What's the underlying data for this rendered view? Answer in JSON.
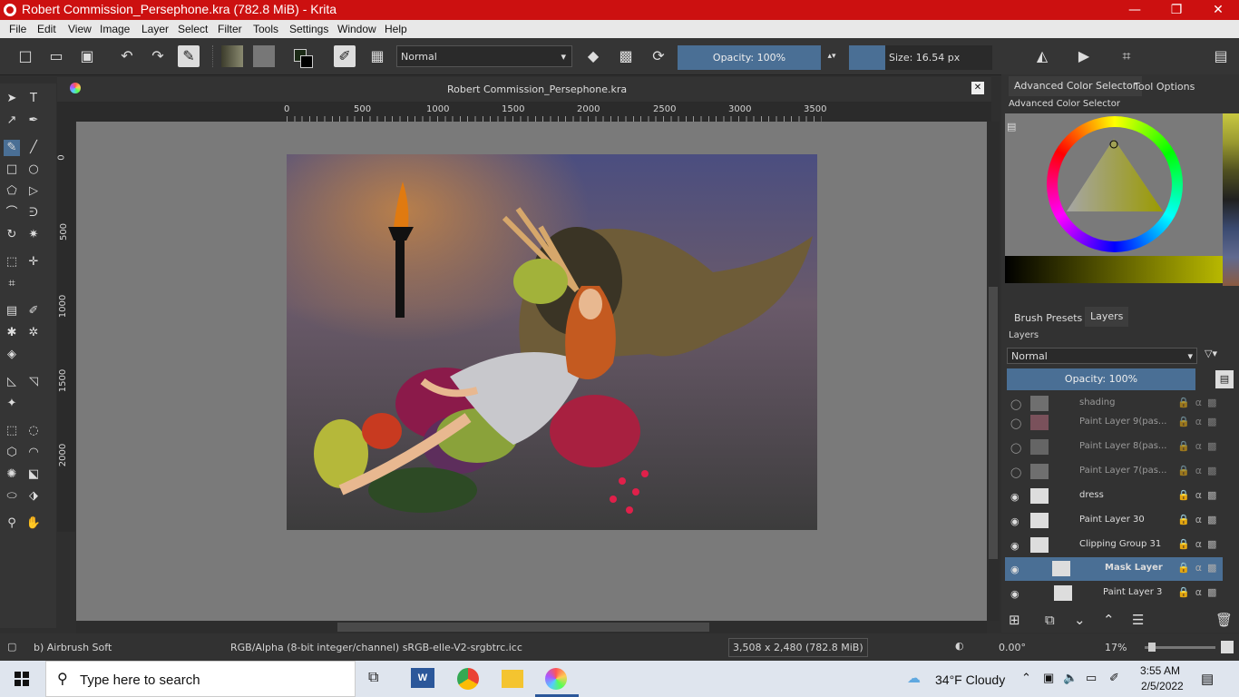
{
  "window": {
    "title": "Robert Commission_Persephone.kra (782.8 MiB)  - Krita",
    "minimize": "—",
    "maximize": "❐",
    "close": "✕"
  },
  "menu": [
    "File",
    "Edit",
    "View",
    "Image",
    "Layer",
    "Select",
    "Filter",
    "Tools",
    "Settings",
    "Window",
    "Help"
  ],
  "toolbar": {
    "blend_mode": "Normal",
    "opacity": "Opacity: 100%",
    "size": "Size: 16.54 px"
  },
  "document": {
    "tab_title": "Robert Commission_Persephone.kra"
  },
  "ruler": {
    "h_ticks": [
      "0",
      "500",
      "1000",
      "1500",
      "2000",
      "2500",
      "3000",
      "3500"
    ],
    "v_ticks": [
      "0",
      "500",
      "1000",
      "1500",
      "2000"
    ]
  },
  "right_panel": {
    "tabs": [
      "Advanced Color Selector",
      "Tool Options"
    ],
    "color_selector_title": "Advanced Color Selector",
    "lower_tabs": [
      "Brush Presets",
      "Layers"
    ],
    "layers_title": "Layers",
    "layer_blend": "Normal",
    "layer_opacity": "Opacity:  100%",
    "layers": [
      {
        "name": "shading",
        "visible": false,
        "selected": false
      },
      {
        "name": "Paint Layer 9(pas...",
        "visible": false,
        "selected": false
      },
      {
        "name": "Paint Layer 8(pas...",
        "visible": false,
        "selected": false
      },
      {
        "name": "Paint Layer 7(pas...",
        "visible": false,
        "selected": false
      },
      {
        "name": "dress",
        "visible": true,
        "selected": false
      },
      {
        "name": "Paint Layer 30",
        "visible": true,
        "selected": false
      },
      {
        "name": "Clipping Group 31",
        "visible": true,
        "selected": false
      },
      {
        "name": "Mask Layer",
        "visible": true,
        "selected": true
      },
      {
        "name": "Paint Layer 3",
        "visible": true,
        "selected": false
      }
    ]
  },
  "status": {
    "brush": "b) Airbrush Soft",
    "color_space": "RGB/Alpha (8-bit integer/channel)  sRGB-elle-V2-srgbtrc.icc",
    "dimensions": "3,508 x 2,480 (782.8 MiB)",
    "rotation": "0.00°",
    "zoom": "17%"
  },
  "taskbar": {
    "search_placeholder": "Type here to search",
    "weather": "34°F  Cloudy",
    "time": "3:55 AM",
    "date": "2/5/2022"
  },
  "colors": {
    "title_red": "#cc1010",
    "selection_blue": "#4a6f95"
  }
}
